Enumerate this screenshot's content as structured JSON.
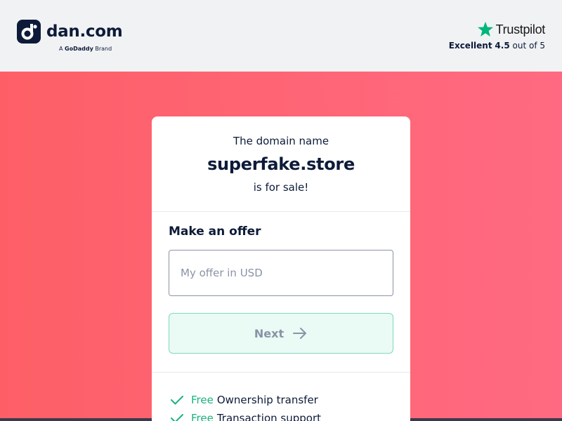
{
  "header": {
    "logo": {
      "brand": "dan.com",
      "sub_prefix": "A",
      "sub_company": "GoDaddy",
      "sub_suffix": "Brand"
    },
    "trustpilot": {
      "name": "Trustpilot",
      "rating_word": "Excellent",
      "score": "4.5",
      "scale": "out of 5"
    }
  },
  "card": {
    "intro": "The domain name",
    "domain": "superfake.store",
    "status": "is for sale!",
    "offer": {
      "title": "Make an offer",
      "input_placeholder": "My offer in USD",
      "input_value": "",
      "next_label": "Next"
    },
    "benefits": [
      {
        "tag": "Free",
        "text": "Ownership transfer"
      },
      {
        "tag": "Free",
        "text": "Transaction support"
      }
    ]
  },
  "colors": {
    "navy": "#0d1b39",
    "hero_left": "#fe5f67",
    "hero_right": "#ff6a82",
    "accent_green": "#19b37b",
    "trustpilot_green": "#00b67a"
  },
  "icons": {
    "logo": "dan-logo-icon",
    "trustpilot": "star-icon",
    "next": "arrow-right-icon",
    "benefit": "check-icon"
  }
}
